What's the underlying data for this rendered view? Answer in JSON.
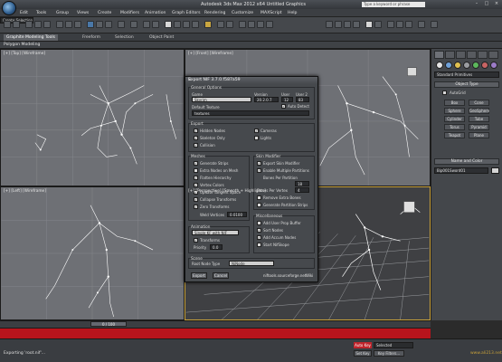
{
  "window": {
    "title": "Autodesk 3ds Max 2012 x64   Untitled   Graphics",
    "search_placeholder": "Type a keyword or phrase"
  },
  "menu": [
    "Edit",
    "Tools",
    "Group",
    "Views",
    "Create",
    "Modifiers",
    "Animation",
    "Graph Editors",
    "Rendering",
    "Customize",
    "MAXScript",
    "Help"
  ],
  "toolbar": {
    "create_selection": "Create Selection"
  },
  "ribbon": {
    "tabs": [
      "Graphite Modeling Tools",
      "Freeform",
      "Selection",
      "Object Paint"
    ],
    "active_tab": 0,
    "panel_label": "Polygon Modeling"
  },
  "viewports": {
    "top": "[+] [Top] [Wireframe]",
    "front": "[+] [Front] [Wireframe]",
    "left": "[+] [Left] [Wireframe]",
    "perspective": "[+] [Perspective] [Smooth + Highlights]"
  },
  "command_panel": {
    "dropdown": "Standard Primitives",
    "object_type_title": "Object Type",
    "autogrid": "AutoGrid",
    "buttons": [
      "Box",
      "Cone",
      "Sphere",
      "GeoSphere",
      "Cylinder",
      "Tube",
      "Torus",
      "Pyramid",
      "Teapot",
      "Plane"
    ],
    "name_color_title": "Name and Color",
    "name_value": "Bip001Sword01"
  },
  "timeline": {
    "slider": "0 / 100"
  },
  "status": {
    "prompt": "Exporting 'root.nif'...",
    "auto_key": "Auto Key",
    "selected": "Selected",
    "set_key": "Set Key",
    "key_filters": "Key Filters...",
    "watermark": "www.ali213.net"
  },
  "dialog": {
    "title": "Export NIF 3.7.0.f587a59",
    "general_options": "General Options",
    "game_label": "Game",
    "game_value": "Skyrim",
    "version_label": "Version",
    "version_value": "20.2.0.7",
    "user_label": "User",
    "user_value": "12",
    "user2_label": "User 2",
    "user2_value": "83",
    "auto_detect": "Auto Detect",
    "default_texture_label": "Default Texture",
    "default_texture_value": "textures",
    "export_group": "Export",
    "hidden_nodes": "Hidden Nodes",
    "skeleton_only": "Skeleton Only",
    "collision": "Collision",
    "cameras": "Cameras",
    "lights": "Lights",
    "meshes_group": "Meshes",
    "generate_strips": "Generate Strips",
    "extra_nodes": "Extra Nodes on Mesh",
    "flatten_hierarchy": "Flatten Hierarchy",
    "vertex_colors": "Vertex Colors",
    "update_tangent": "Update Tangent Space",
    "collapse_transforms": "Collapse Transforms",
    "zero_transforms": "Zero Transforms",
    "weld_vertices_label": "Weld Vertices",
    "weld_vertices_value": "0.0100",
    "skin_modifier_group": "Skin Modifier",
    "export_skin": "Export Skin Modifier",
    "enable_partitions": "Enable Multiple Partitions",
    "bones_per_partition_label": "Bones Per Partition",
    "bones_per_partition_value": "18",
    "bones_per_vertex_label": "Bones Per Vertex",
    "bones_per_vertex_value": "4",
    "remove_extra_bones": "Remove Extra Bones",
    "generate_partition_strips": "Generate Partition Strips",
    "animation_group": "Animation",
    "animation_value": "Single KF with NIF",
    "transforms": "Transforms",
    "priority_label": "Priority",
    "priority_value": "0.0",
    "misc_group": "Miscellaneous",
    "add_user_prop": "Add User Prop Buffer",
    "sort_nodes": "Sort Nodes",
    "add_accum_nodes": "Add Accum Nodes",
    "start_nifskope": "Start NifSkope",
    "scene_group": "Scene",
    "root_node_label": "Root Node Type",
    "root_node_value": "NiNode",
    "export_btn": "Export",
    "cancel_btn": "Cancel",
    "link": "niftools.sourceforge.net",
    "wiki": "Wiki"
  }
}
